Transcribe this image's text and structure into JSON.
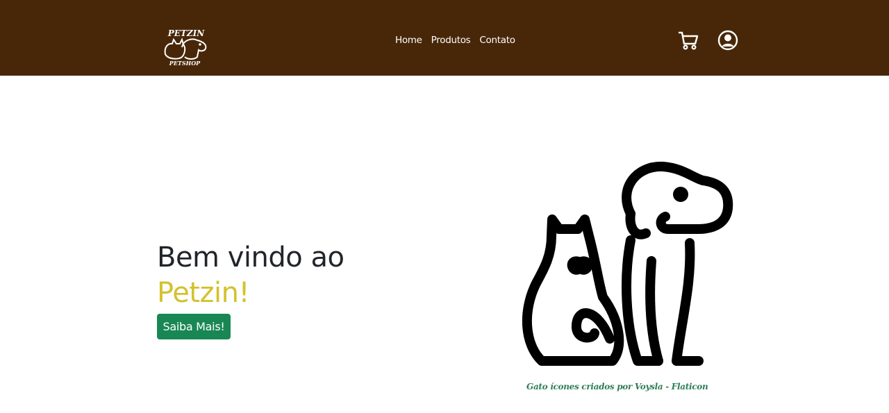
{
  "header": {
    "logo": {
      "icon": "petzin-logo-icon",
      "line1": "PETZIN",
      "line2": "PETSHOP"
    },
    "nav": [
      {
        "label": "Home"
      },
      {
        "label": "Produtos"
      },
      {
        "label": "Contato"
      }
    ],
    "cart_icon": "cart-icon",
    "user_icon": "user-circle-icon"
  },
  "hero": {
    "title": "Bem vindo ao",
    "brand": "Petzin!",
    "button_label": "Saiba Mais!",
    "illustration_icon": "cat-and-dog-icon",
    "credit": "Gato ícones criados por Voysla - Flaticon"
  },
  "colors": {
    "navbar": "#482709",
    "brand": "#d4c12e",
    "button": "#198754",
    "credit": "#2e7d57"
  }
}
